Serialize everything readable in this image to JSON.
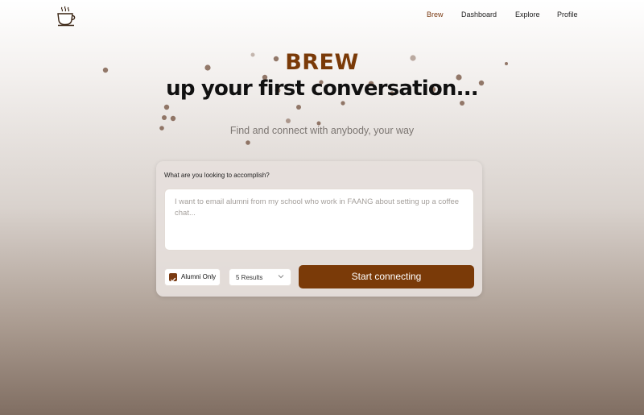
{
  "nav": {
    "logo_icon": "coffee-cup-icon",
    "links": [
      "Brew",
      "Dashboard",
      "Explore",
      "Profile"
    ],
    "active_link": "Brew"
  },
  "hero": {
    "title": "BREW",
    "subtitle": "up your first conversation...",
    "tagline": "Find and connect with anybody, your way"
  },
  "form": {
    "label": "What are you looking to accomplish?",
    "input_placeholder": "I want to email alumni from my school who work in FAANG about setting up a coffee chat...",
    "input_value": "",
    "alumni_only_label": "Alumni Only",
    "alumni_only_checked": true,
    "results_select_value": "5 Results",
    "submit_label": "Start connecting"
  },
  "colors": {
    "brand": "#7a3a08",
    "background_top": "#ffffff",
    "background_bottom": "#806e62"
  }
}
